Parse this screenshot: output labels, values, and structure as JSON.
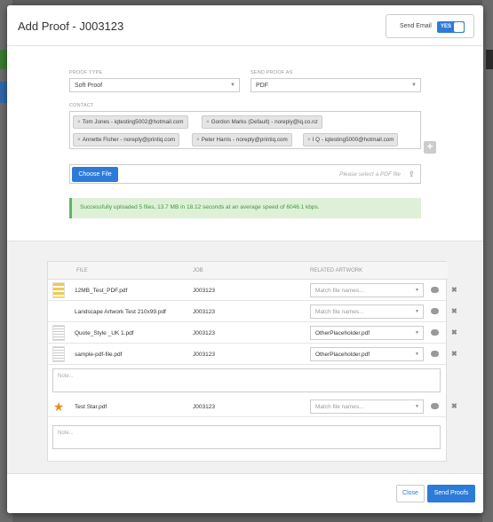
{
  "modal": {
    "title": "Add Proof - J003123",
    "send_email": {
      "label": "Send Email",
      "toggle_state": "YES"
    }
  },
  "form": {
    "proof_type": {
      "label": "PROOF TYPE",
      "value": "Soft Proof"
    },
    "send_proof_as": {
      "label": "SEND PROOF AS",
      "value": "PDF"
    },
    "contact": {
      "label": "CONTACT",
      "chips": [
        "Tom Jones - iqtesting5002@hotmail.com",
        "Gordon Marks (Default) - noreply@iq.co.nz",
        "Annette Fisher - noreply@printiq.com",
        "Peter Harris - noreply@printiq.com",
        "I Q - iqtesting5000@hotmail.com"
      ]
    },
    "file": {
      "button": "Choose File",
      "placeholder": "Please select a PDF file"
    },
    "success_message": "Successfully uploaded 5 files, 13.7 MB in 18.12 seconds at an average speed of 6046.1 kbps."
  },
  "table": {
    "headers": {
      "file": "FILE",
      "job": "JOB",
      "artwork": "RELATED ARTWORK"
    },
    "rows": [
      {
        "file": "12MB_Test_PDF.pdf",
        "job": "J003123",
        "artwork": "Match file names..."
      },
      {
        "file": "Landscape Artwork Test 210x99.pdf",
        "job": "J003123",
        "artwork": "Match file names..."
      },
      {
        "file": "Quote_Style _UK 1.pdf",
        "job": "J003123",
        "artwork": "OtherPlaceholder.pdf"
      },
      {
        "file": "sample-pdf-file.pdf",
        "job": "J003123",
        "artwork": "OtherPlaceholder.pdf"
      },
      {
        "file": "Test Star.pdf",
        "job": "J003123",
        "artwork": "Match file names..."
      }
    ],
    "note_placeholder": "Note..."
  },
  "footer": {
    "close": "Close",
    "send": "Send Proofs"
  }
}
